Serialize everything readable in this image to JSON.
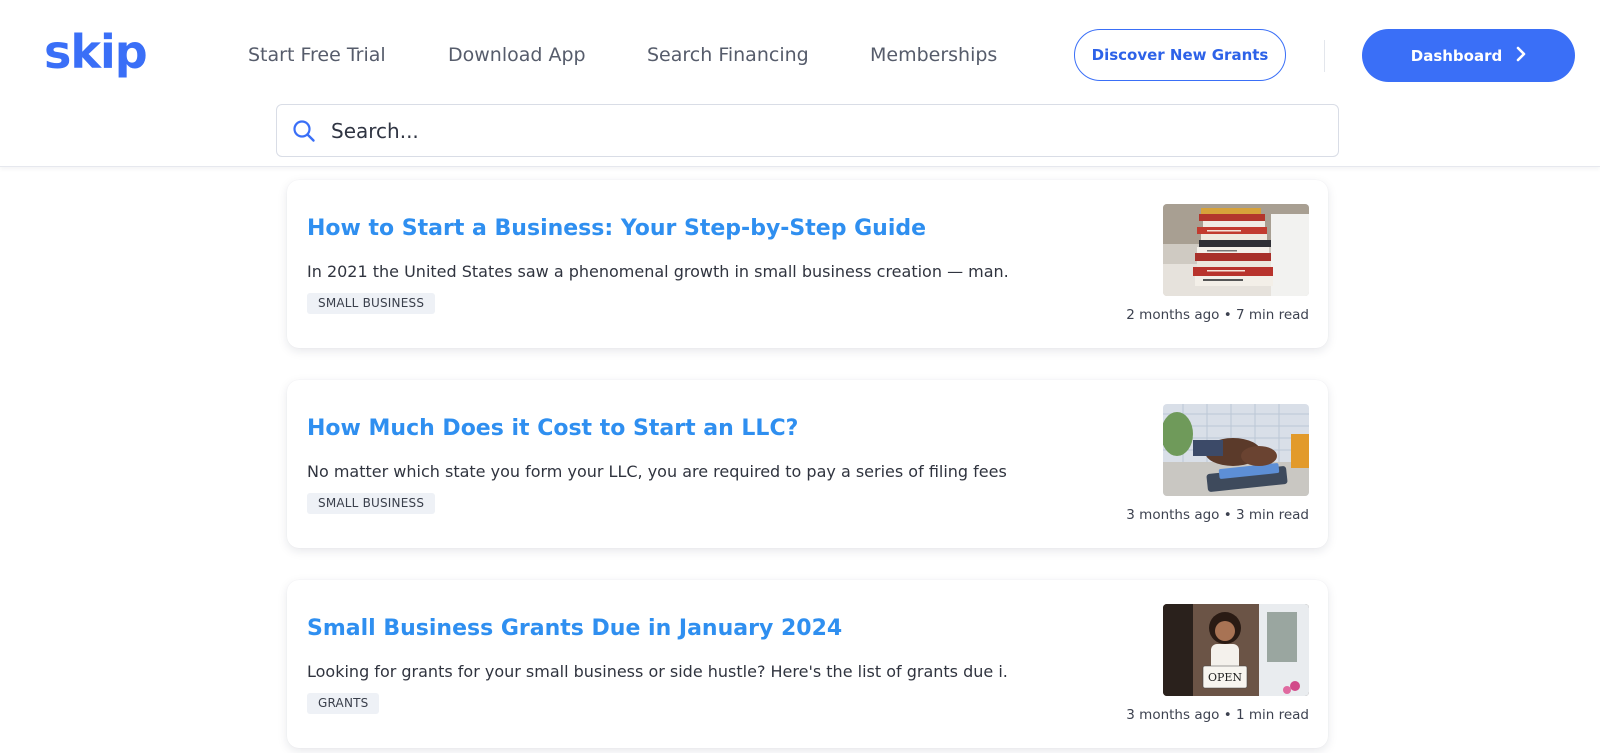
{
  "brand": {
    "logo": "skip",
    "accent": "#3a6ff7",
    "title_color": "#2f8ff0"
  },
  "nav": {
    "links": [
      "Start Free Trial",
      "Download App",
      "Search Financing",
      "Memberships"
    ],
    "discover_label": "Discover New Grants",
    "dashboard_label": "Dashboard",
    "dashboard_icon": "chevron-right-icon"
  },
  "search": {
    "placeholder": "Search...",
    "value": "",
    "icon": "search-icon"
  },
  "articles": [
    {
      "title": "How to Start a Business: Your Step-by-Step Guide",
      "excerpt": "In 2021 the United States saw a phenomenal growth in small business creation — man...",
      "tag": "SMALL BUSINESS",
      "meta": "2 months ago • 7 min read",
      "image": "stack-of-books-photo"
    },
    {
      "title": "How Much Does it Cost to Start an LLC?",
      "excerpt": "No matter which state you form your LLC, you are required to pay a series of filing fees...",
      "tag": "SMALL BUSINESS",
      "meta": "3 months ago • 3 min read",
      "image": "hands-on-calculator-photo"
    },
    {
      "title": "Small Business Grants Due in January 2024",
      "excerpt": "Looking for grants for your small business or side hustle? Here's the list of grants due i...",
      "tag": "GRANTS",
      "meta": "3 months ago • 1 min read",
      "image": "woman-holding-open-sign-photo",
      "image_text": "OPEN"
    }
  ]
}
